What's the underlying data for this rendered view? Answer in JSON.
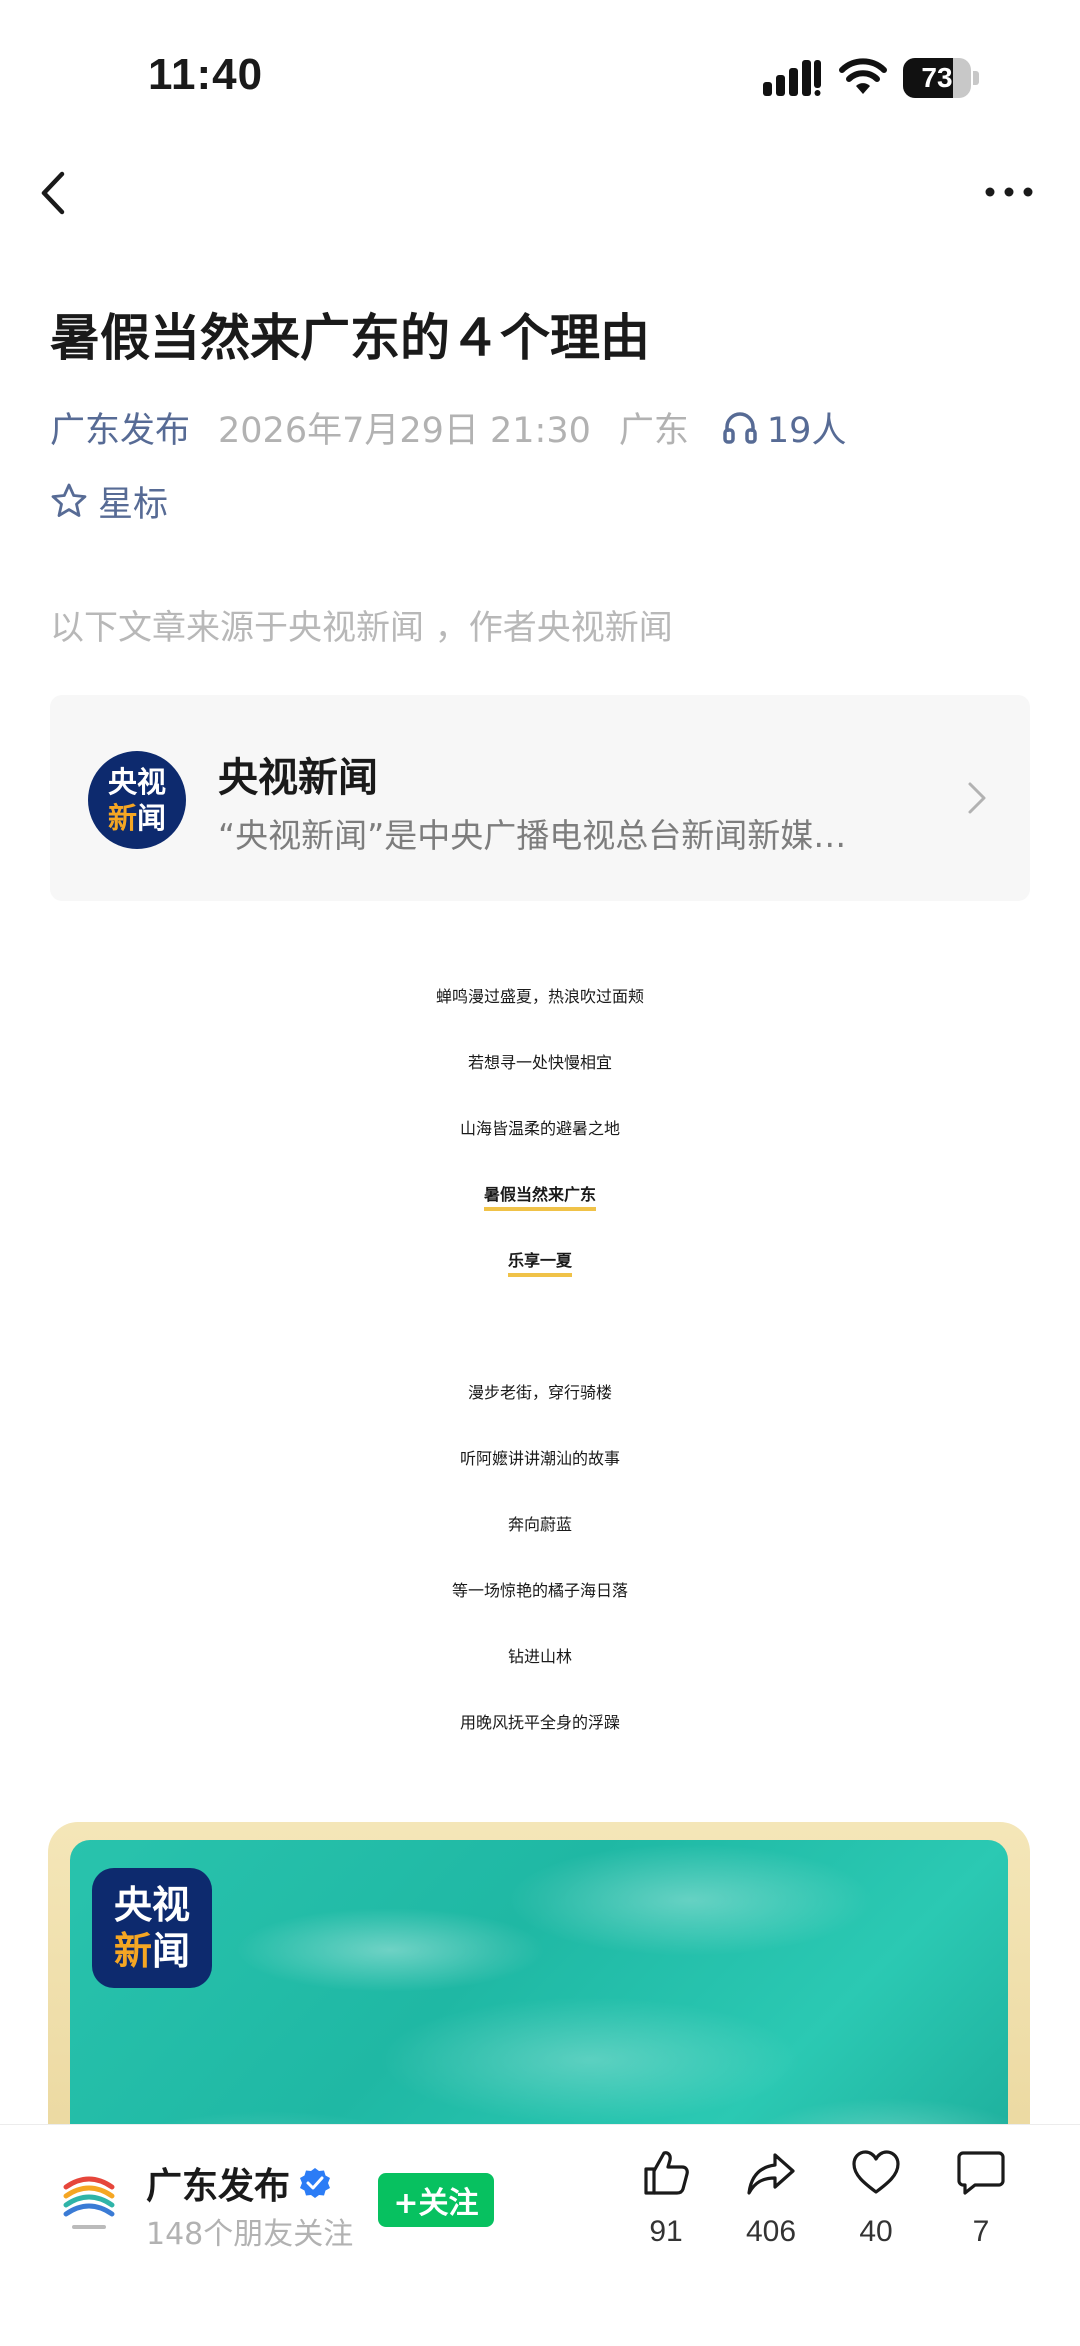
{
  "status_bar": {
    "time": "11:40",
    "battery": "73",
    "battery_level": 0.73
  },
  "article": {
    "title": "暑假当然来广东的４个理由",
    "author": "广东发布",
    "date": "2026年7月29日 21:30",
    "location": "广东",
    "listeners": "19人",
    "star_label": "星标",
    "source_note": "以下文章来源于央视新闻 ，作者央视新闻"
  },
  "source_card": {
    "avatar_line1": "央视",
    "avatar_line2_a": "新",
    "avatar_line2_b": "闻",
    "name": "央视新闻",
    "description": "“央视新闻”是中央广播电视总台新闻新媒…"
  },
  "poem": {
    "stanza1": [
      "蝉鸣漫过盛夏，热浪吹过面颊",
      "若想寻一处快慢相宜",
      "山海皆温柔的避暑之地"
    ],
    "highlight": [
      "暑假当然来广东",
      "乐享一夏"
    ],
    "stanza2": [
      "漫步老街，穿行骑楼",
      "听阿嬷讲讲潮汕的故事",
      "奔向蔚蓝",
      "等一场惊艳的橘子海日落",
      "钻进山林",
      "用晚风抚平全身的浮躁"
    ]
  },
  "image": {
    "logo_line1": "央视",
    "logo_line2_a": "新",
    "logo_line2_b": "闻"
  },
  "bottom_bar": {
    "account_name": "广东发布",
    "followers": "148个朋友关注",
    "follow_label": "+关注",
    "actions": [
      {
        "icon": "thumbs-up-icon",
        "count": "91"
      },
      {
        "icon": "share-icon",
        "count": "406"
      },
      {
        "icon": "heart-icon",
        "count": "40"
      },
      {
        "icon": "comment-icon",
        "count": "7"
      }
    ]
  },
  "colors": {
    "link_blue": "#576b95",
    "wechat_green": "#07c160",
    "highlight_underline": "#f0c248",
    "cctv_navy": "#0d2a6e"
  }
}
